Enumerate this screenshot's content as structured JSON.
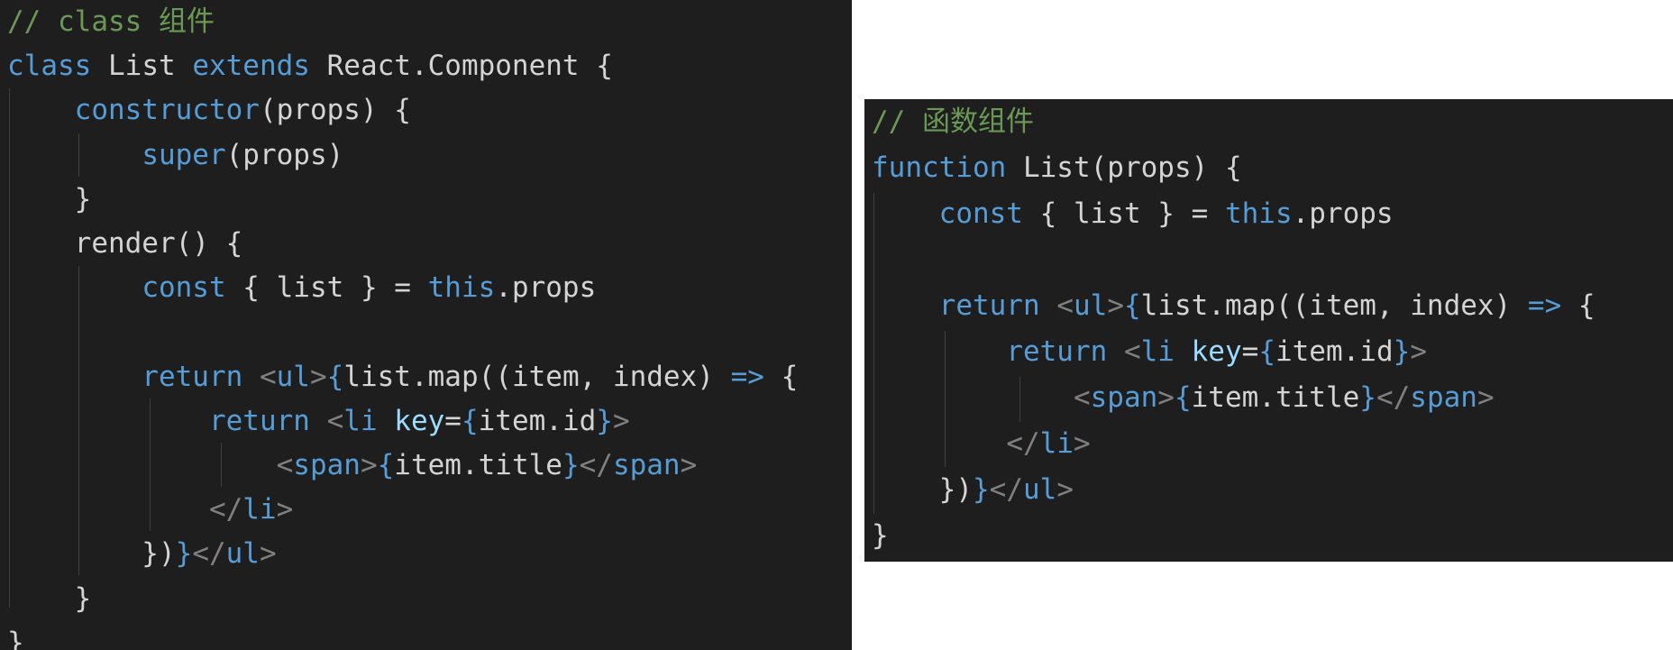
{
  "colors": {
    "background": "#1e1e1e",
    "comment": "#6a9955",
    "keyword": "#569cd6",
    "text": "#d4d4d4",
    "punctuation_tag": "#808080",
    "attribute": "#9cdcfe"
  },
  "left_panel": {
    "lines": [
      [
        {
          "t": "// class 组件",
          "c": "cm"
        }
      ],
      [
        {
          "t": "class",
          "c": "kw"
        },
        {
          "t": " List ",
          "c": "tx"
        },
        {
          "t": "extends",
          "c": "kw"
        },
        {
          "t": " React.Component {",
          "c": "tx"
        }
      ],
      [
        {
          "t": "    ",
          "c": "tx"
        },
        {
          "t": "constructor",
          "c": "kw"
        },
        {
          "t": "(props) {",
          "c": "tx"
        }
      ],
      [
        {
          "t": "        ",
          "c": "tx"
        },
        {
          "t": "super",
          "c": "kw"
        },
        {
          "t": "(props)",
          "c": "tx"
        }
      ],
      [
        {
          "t": "    }",
          "c": "tx"
        }
      ],
      [
        {
          "t": "    render() {",
          "c": "tx"
        }
      ],
      [
        {
          "t": "        ",
          "c": "tx"
        },
        {
          "t": "const",
          "c": "kw"
        },
        {
          "t": " { list } = ",
          "c": "tx"
        },
        {
          "t": "this",
          "c": "kw"
        },
        {
          "t": ".props",
          "c": "tx"
        }
      ],
      [
        {
          "t": "",
          "c": "tx"
        }
      ],
      [
        {
          "t": "        ",
          "c": "tx"
        },
        {
          "t": "return",
          "c": "kw"
        },
        {
          "t": " ",
          "c": "tx"
        },
        {
          "t": "<",
          "c": "pu"
        },
        {
          "t": "ul",
          "c": "tg"
        },
        {
          "t": ">",
          "c": "pu"
        },
        {
          "t": "{",
          "c": "br"
        },
        {
          "t": "list.map((item, index) ",
          "c": "tx"
        },
        {
          "t": "=>",
          "c": "kw"
        },
        {
          "t": " {",
          "c": "tx"
        }
      ],
      [
        {
          "t": "            ",
          "c": "tx"
        },
        {
          "t": "return",
          "c": "kw"
        },
        {
          "t": " ",
          "c": "tx"
        },
        {
          "t": "<",
          "c": "pu"
        },
        {
          "t": "li",
          "c": "tg"
        },
        {
          "t": " ",
          "c": "tx"
        },
        {
          "t": "key",
          "c": "at"
        },
        {
          "t": "=",
          "c": "tx"
        },
        {
          "t": "{",
          "c": "br"
        },
        {
          "t": "item.id",
          "c": "tx"
        },
        {
          "t": "}",
          "c": "br"
        },
        {
          "t": ">",
          "c": "pu"
        }
      ],
      [
        {
          "t": "                ",
          "c": "tx"
        },
        {
          "t": "<",
          "c": "pu"
        },
        {
          "t": "span",
          "c": "tg"
        },
        {
          "t": ">",
          "c": "pu"
        },
        {
          "t": "{",
          "c": "br"
        },
        {
          "t": "item.title",
          "c": "tx"
        },
        {
          "t": "}",
          "c": "br"
        },
        {
          "t": "</",
          "c": "pu"
        },
        {
          "t": "span",
          "c": "tg"
        },
        {
          "t": ">",
          "c": "pu"
        }
      ],
      [
        {
          "t": "            ",
          "c": "tx"
        },
        {
          "t": "</",
          "c": "pu"
        },
        {
          "t": "li",
          "c": "tg"
        },
        {
          "t": ">",
          "c": "pu"
        }
      ],
      [
        {
          "t": "        })",
          "c": "tx"
        },
        {
          "t": "}",
          "c": "br"
        },
        {
          "t": "</",
          "c": "pu"
        },
        {
          "t": "ul",
          "c": "tg"
        },
        {
          "t": ">",
          "c": "pu"
        }
      ],
      [
        {
          "t": "    }",
          "c": "tx"
        }
      ],
      [
        {
          "t": "}",
          "c": "tx"
        }
      ]
    ]
  },
  "right_panel": {
    "lines": [
      [
        {
          "t": "// 函数组件",
          "c": "cm"
        }
      ],
      [
        {
          "t": "function",
          "c": "kw"
        },
        {
          "t": " List(props) {",
          "c": "tx"
        }
      ],
      [
        {
          "t": "    ",
          "c": "tx"
        },
        {
          "t": "const",
          "c": "kw"
        },
        {
          "t": " { list } = ",
          "c": "tx"
        },
        {
          "t": "this",
          "c": "kw"
        },
        {
          "t": ".props",
          "c": "tx"
        }
      ],
      [
        {
          "t": "",
          "c": "tx"
        }
      ],
      [
        {
          "t": "    ",
          "c": "tx"
        },
        {
          "t": "return",
          "c": "kw"
        },
        {
          "t": " ",
          "c": "tx"
        },
        {
          "t": "<",
          "c": "pu"
        },
        {
          "t": "ul",
          "c": "tg"
        },
        {
          "t": ">",
          "c": "pu"
        },
        {
          "t": "{",
          "c": "br"
        },
        {
          "t": "list.map((item, index) ",
          "c": "tx"
        },
        {
          "t": "=>",
          "c": "kw"
        },
        {
          "t": " {",
          "c": "tx"
        }
      ],
      [
        {
          "t": "        ",
          "c": "tx"
        },
        {
          "t": "return",
          "c": "kw"
        },
        {
          "t": " ",
          "c": "tx"
        },
        {
          "t": "<",
          "c": "pu"
        },
        {
          "t": "li",
          "c": "tg"
        },
        {
          "t": " ",
          "c": "tx"
        },
        {
          "t": "key",
          "c": "at"
        },
        {
          "t": "=",
          "c": "tx"
        },
        {
          "t": "{",
          "c": "br"
        },
        {
          "t": "item.id",
          "c": "tx"
        },
        {
          "t": "}",
          "c": "br"
        },
        {
          "t": ">",
          "c": "pu"
        }
      ],
      [
        {
          "t": "            ",
          "c": "tx"
        },
        {
          "t": "<",
          "c": "pu"
        },
        {
          "t": "span",
          "c": "tg"
        },
        {
          "t": ">",
          "c": "pu"
        },
        {
          "t": "{",
          "c": "br"
        },
        {
          "t": "item.title",
          "c": "tx"
        },
        {
          "t": "}",
          "c": "br"
        },
        {
          "t": "</",
          "c": "pu"
        },
        {
          "t": "span",
          "c": "tg"
        },
        {
          "t": ">",
          "c": "pu"
        }
      ],
      [
        {
          "t": "        ",
          "c": "tx"
        },
        {
          "t": "</",
          "c": "pu"
        },
        {
          "t": "li",
          "c": "tg"
        },
        {
          "t": ">",
          "c": "pu"
        }
      ],
      [
        {
          "t": "    })",
          "c": "tx"
        },
        {
          "t": "}",
          "c": "br"
        },
        {
          "t": "</",
          "c": "pu"
        },
        {
          "t": "ul",
          "c": "tg"
        },
        {
          "t": ">",
          "c": "pu"
        }
      ],
      [
        {
          "t": "}",
          "c": "tx"
        }
      ]
    ]
  }
}
